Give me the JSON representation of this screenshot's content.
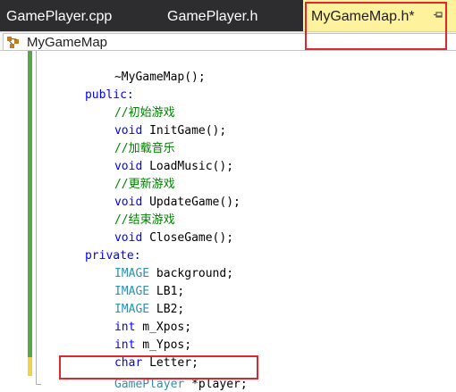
{
  "tabs": [
    {
      "label": "GamePlayer.cpp",
      "active": false
    },
    {
      "label": "GamePlayer.h",
      "active": false
    },
    {
      "label": "MyGameMap.h*",
      "active": true
    }
  ],
  "navigation": {
    "scope": "MyGameMap"
  },
  "code": {
    "destructor": "~MyGameMap();",
    "public_kw": "public:",
    "cm_init": "//初始游戏",
    "void1": "void",
    "fn_init": " InitGame();",
    "cm_music": "//加载音乐",
    "void2": "void",
    "fn_music": " LoadMusic();",
    "cm_update": "//更新游戏",
    "void3": "void",
    "fn_update": " UpdateGame();",
    "cm_close": "//结束游戏",
    "void4": "void",
    "fn_close": " CloseGame();",
    "private_kw": "private:",
    "type_image1": "IMAGE",
    "var_background": " background;",
    "type_image2": "IMAGE",
    "var_lb1": " LB1;",
    "type_image3": "IMAGE",
    "var_lb2": " LB2;",
    "int1": "int",
    "var_xpos": " m_Xpos;",
    "int2": "int",
    "var_ypos": " m_Ypos;",
    "char_kw": "char",
    "var_letter": " Letter;",
    "type_player": "GamePlayer",
    "var_player": " *player;",
    "closing": "};"
  },
  "colors": {
    "keyword": "#0000ff",
    "comment": "#008000",
    "type": "#2b91af",
    "active_tab": "#fff29d",
    "tab_bar": "#2d2d30",
    "annotation": "#e0262f"
  }
}
